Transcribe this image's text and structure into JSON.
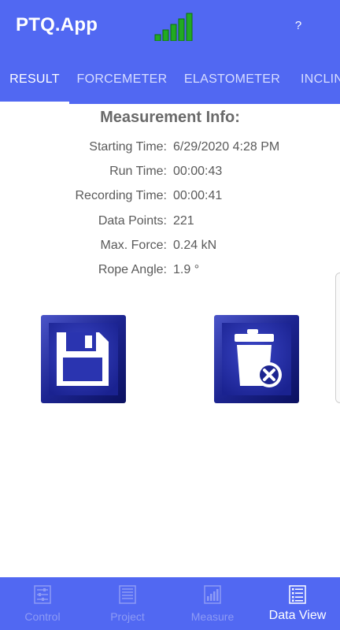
{
  "app": {
    "title": "PTQ.App",
    "help_label": "?",
    "signal_icon": "signal-strength-icon",
    "accent_color": "#5168f2",
    "signal_color": "#22aa22"
  },
  "tabs": [
    {
      "label": "RESULT",
      "active": true
    },
    {
      "label": "FORCEMETER",
      "active": false
    },
    {
      "label": "ELASTOMETER",
      "active": false
    },
    {
      "label": "INCLIN",
      "active": false
    }
  ],
  "measurement_info": {
    "title": "Measurement Info:",
    "rows": [
      {
        "label": "Starting Time:",
        "value": "6/29/2020 4:28 PM"
      },
      {
        "label": "Run Time:",
        "value": "00:00:43"
      },
      {
        "label": "Recording Time:",
        "value": "00:00:41"
      },
      {
        "label": "Data Points:",
        "value": "221"
      },
      {
        "label": "Max. Force:",
        "value": "0.24 kN"
      },
      {
        "label": "Rope Angle:",
        "value": "1.9 °"
      }
    ]
  },
  "actions": {
    "save_icon": "floppy-disk-icon",
    "delete_icon": "trash-delete-icon"
  },
  "bottom_nav": [
    {
      "label": "Control",
      "icon": "sliders-icon",
      "active": false
    },
    {
      "label": "Project",
      "icon": "document-list-icon",
      "active": false
    },
    {
      "label": "Measure",
      "icon": "bar-chart-icon",
      "active": false
    },
    {
      "label": "Data View",
      "icon": "list-view-icon",
      "active": true
    }
  ]
}
